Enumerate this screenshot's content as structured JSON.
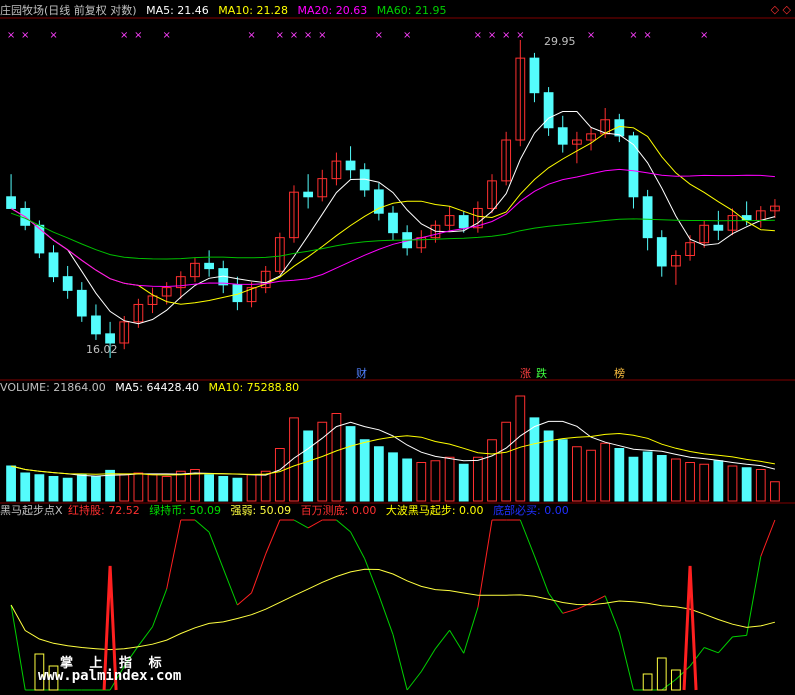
{
  "header": {
    "stock_name": "庄园牧场(日线 前复权 对数)",
    "ma5": "MA5: 21.46",
    "ma10": "MA10: 21.28",
    "ma20": "MA20: 20.63",
    "ma60": "MA60: 21.95"
  },
  "volume_header": {
    "volume": "VOLUME: 21864.00",
    "ma5": "MA5: 64428.40",
    "ma10": "MA10: 75288.80"
  },
  "indicator_header": {
    "name": "黑马起步点X",
    "red_stock": "红持股: 72.52",
    "green_coin": "绿持币: 50.09",
    "strength": "强弱: 50.09",
    "million_bottom": "百万测底: 0.00",
    "wave_horse": "大波黑马起步: 0.00",
    "bottom_buy": "底部必买: 0.00"
  },
  "annotations": {
    "high_label": "29.95",
    "low_label": "16.02",
    "cai": "财",
    "zhang": "涨",
    "die": "跌",
    "bang": "榜"
  },
  "watermark": {
    "cn": "掌 上 指 标",
    "url": "www.palmindex.com"
  },
  "colors": {
    "up": "#ff3030",
    "down": "#54fcfc",
    "ma5": "#ffffff",
    "ma10": "#ffff00",
    "ma20": "#ff00ff",
    "ma60": "#00c000",
    "red_line": "#ff2020",
    "green_line": "#00d000",
    "strength_line": "#ffff40",
    "bottom_buy": "#0000ff"
  },
  "chart_data": [
    {
      "type": "candlestick",
      "price_high": 29.95,
      "price_low": 16.02,
      "candles": [
        [
          22.0,
          23.0,
          21.5,
          21.5
        ],
        [
          21.5,
          21.8,
          20.6,
          20.8
        ],
        [
          20.8,
          21.0,
          19.5,
          19.7
        ],
        [
          19.7,
          20.0,
          18.6,
          18.8
        ],
        [
          18.8,
          19.2,
          18.0,
          18.3
        ],
        [
          18.3,
          18.6,
          17.2,
          17.4
        ],
        [
          17.4,
          17.8,
          16.6,
          16.8
        ],
        [
          16.8,
          17.2,
          16.02,
          16.5
        ],
        [
          16.5,
          17.4,
          16.3,
          17.2
        ],
        [
          17.2,
          18.0,
          17.0,
          17.8
        ],
        [
          17.8,
          18.4,
          17.5,
          18.1
        ],
        [
          18.1,
          18.6,
          17.8,
          18.4
        ],
        [
          18.4,
          19.0,
          18.0,
          18.8
        ],
        [
          18.8,
          19.5,
          18.6,
          19.3
        ],
        [
          19.3,
          19.8,
          18.8,
          19.1
        ],
        [
          19.1,
          19.4,
          18.2,
          18.5
        ],
        [
          18.5,
          18.8,
          17.6,
          17.9
        ],
        [
          17.9,
          18.6,
          17.7,
          18.4
        ],
        [
          18.4,
          19.2,
          18.2,
          19.0
        ],
        [
          19.0,
          20.5,
          18.9,
          20.3
        ],
        [
          20.3,
          22.5,
          20.1,
          22.2
        ],
        [
          22.2,
          23.0,
          21.5,
          22.0
        ],
        [
          22.0,
          23.2,
          21.8,
          22.8
        ],
        [
          22.8,
          24.0,
          22.5,
          23.6
        ],
        [
          23.6,
          24.3,
          22.8,
          23.2
        ],
        [
          23.2,
          23.5,
          22.0,
          22.3
        ],
        [
          22.3,
          22.6,
          21.0,
          21.3
        ],
        [
          21.3,
          21.6,
          20.2,
          20.5
        ],
        [
          20.5,
          20.8,
          19.6,
          19.9
        ],
        [
          19.9,
          20.6,
          19.7,
          20.3
        ],
        [
          20.3,
          21.0,
          20.1,
          20.8
        ],
        [
          20.8,
          21.6,
          20.6,
          21.2
        ],
        [
          21.2,
          21.4,
          20.5,
          20.7
        ],
        [
          20.7,
          21.8,
          20.5,
          21.5
        ],
        [
          21.5,
          23.0,
          21.3,
          22.7
        ],
        [
          22.7,
          25.0,
          22.5,
          24.6
        ],
        [
          24.6,
          29.95,
          24.3,
          28.9
        ],
        [
          28.9,
          29.2,
          26.5,
          27.0
        ],
        [
          27.0,
          27.3,
          24.8,
          25.2
        ],
        [
          25.2,
          25.8,
          24.0,
          24.4
        ],
        [
          24.4,
          25.0,
          23.5,
          24.6
        ],
        [
          24.6,
          25.2,
          24.1,
          24.9
        ],
        [
          24.9,
          26.2,
          24.7,
          25.6
        ],
        [
          25.6,
          25.9,
          24.5,
          24.8
        ],
        [
          24.8,
          25.0,
          21.5,
          22.0
        ],
        [
          22.0,
          22.3,
          19.8,
          20.3
        ],
        [
          20.3,
          20.6,
          18.8,
          19.2
        ],
        [
          19.2,
          19.8,
          18.5,
          19.6
        ],
        [
          19.6,
          20.4,
          19.4,
          20.1
        ],
        [
          20.1,
          21.0,
          19.9,
          20.8
        ],
        [
          20.8,
          21.4,
          20.2,
          20.6
        ],
        [
          20.6,
          21.5,
          20.4,
          21.2
        ],
        [
          21.2,
          21.8,
          20.8,
          21.0
        ],
        [
          21.0,
          21.6,
          20.7,
          21.4
        ],
        [
          21.4,
          21.9,
          21.1,
          21.6
        ]
      ],
      "ma5_last": 21.46,
      "ma10_last": 21.28,
      "ma20_last": 20.63,
      "ma60_last": 21.95
    },
    {
      "type": "bar",
      "name": "VOLUME",
      "last_volume": 21864.0,
      "values": [
        40,
        32,
        30,
        28,
        26,
        30,
        28,
        35,
        30,
        32,
        30,
        28,
        34,
        36,
        30,
        28,
        26,
        30,
        34,
        60,
        95,
        80,
        90,
        100,
        85,
        70,
        62,
        55,
        48,
        44,
        46,
        50,
        42,
        50,
        70,
        90,
        120,
        95,
        80,
        70,
        62,
        58,
        66,
        60,
        50,
        56,
        52,
        48,
        44,
        42,
        46,
        40,
        38,
        36,
        22
      ],
      "ma5_last": 64428.4,
      "ma10_last": 75288.8
    },
    {
      "type": "line",
      "name": "黑马起步点X",
      "red_hold_last": 72.52,
      "green_hold_last": 50.09,
      "strength_last": 50.09
    }
  ]
}
